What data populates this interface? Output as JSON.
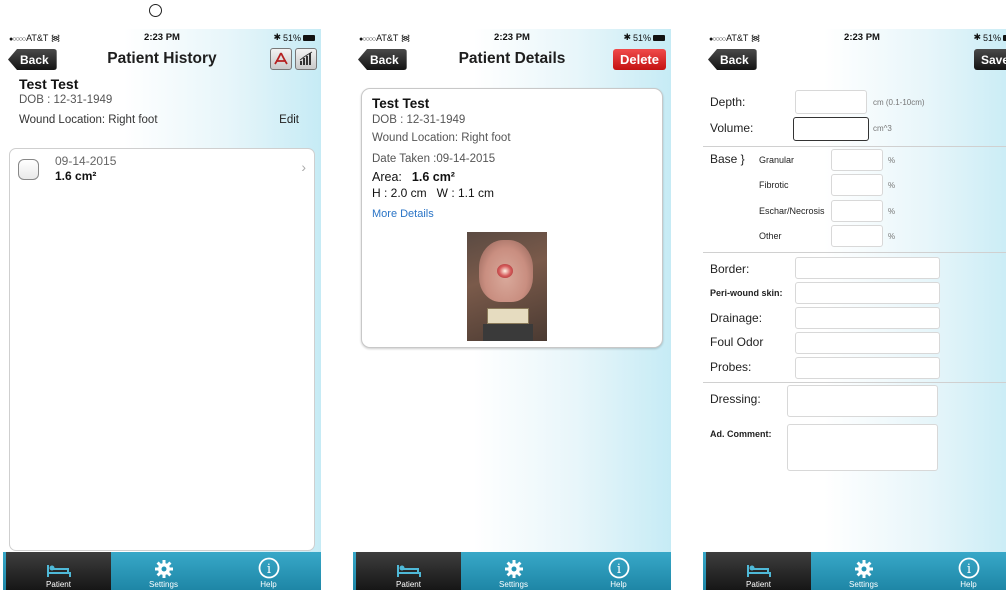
{
  "status": {
    "carrier": "AT&T",
    "time": "2:23 PM",
    "battery": "51%"
  },
  "tabs": [
    {
      "label": "Patient",
      "icon": "bed-icon"
    },
    {
      "label": "Settings",
      "icon": "gear-icon"
    },
    {
      "label": "Help",
      "icon": "info-icon"
    }
  ],
  "screen1": {
    "title": "Patient History",
    "back": "Back",
    "name": "Test Test",
    "dob": "DOB : 12-31-1949",
    "location": "Wound Location: Right foot",
    "edit": "Edit",
    "items": [
      {
        "date": "09-14-2015",
        "area": "1.6 cm²"
      }
    ]
  },
  "screen2": {
    "title": "Patient Details",
    "back": "Back",
    "delete": "Delete",
    "name": "Test Test",
    "dob": "DOB : 12-31-1949",
    "location": "Wound Location: Right foot",
    "date_taken": "Date Taken :09-14-2015",
    "area_label": "Area:",
    "area_value": "1.6 cm²",
    "hw": "H : 2.0 cm   W : 1.1 cm",
    "more": "More Details"
  },
  "screen3": {
    "back": "Back",
    "save": "Save",
    "depth": "Depth:",
    "depth_hint": "cm (0.1-10cm)",
    "volume": "Volume:",
    "volume_hint": "cm^3",
    "base": "Base }",
    "granular": "Granular",
    "fibrotic": "Fibrotic",
    "eschar": "Eschar/Necrosis",
    "other": "Other",
    "pct": "%",
    "border": "Border:",
    "periwound": "Peri-wound skin:",
    "drainage": "Drainage:",
    "foul_odor": "Foul Odor",
    "probes": "Probes:",
    "dressing": "Dressing:",
    "comment": "Ad. Comment:"
  },
  "colors": {
    "tabbar": "#2596b6",
    "delete": "#e02a2a",
    "link": "#2a74c6"
  }
}
